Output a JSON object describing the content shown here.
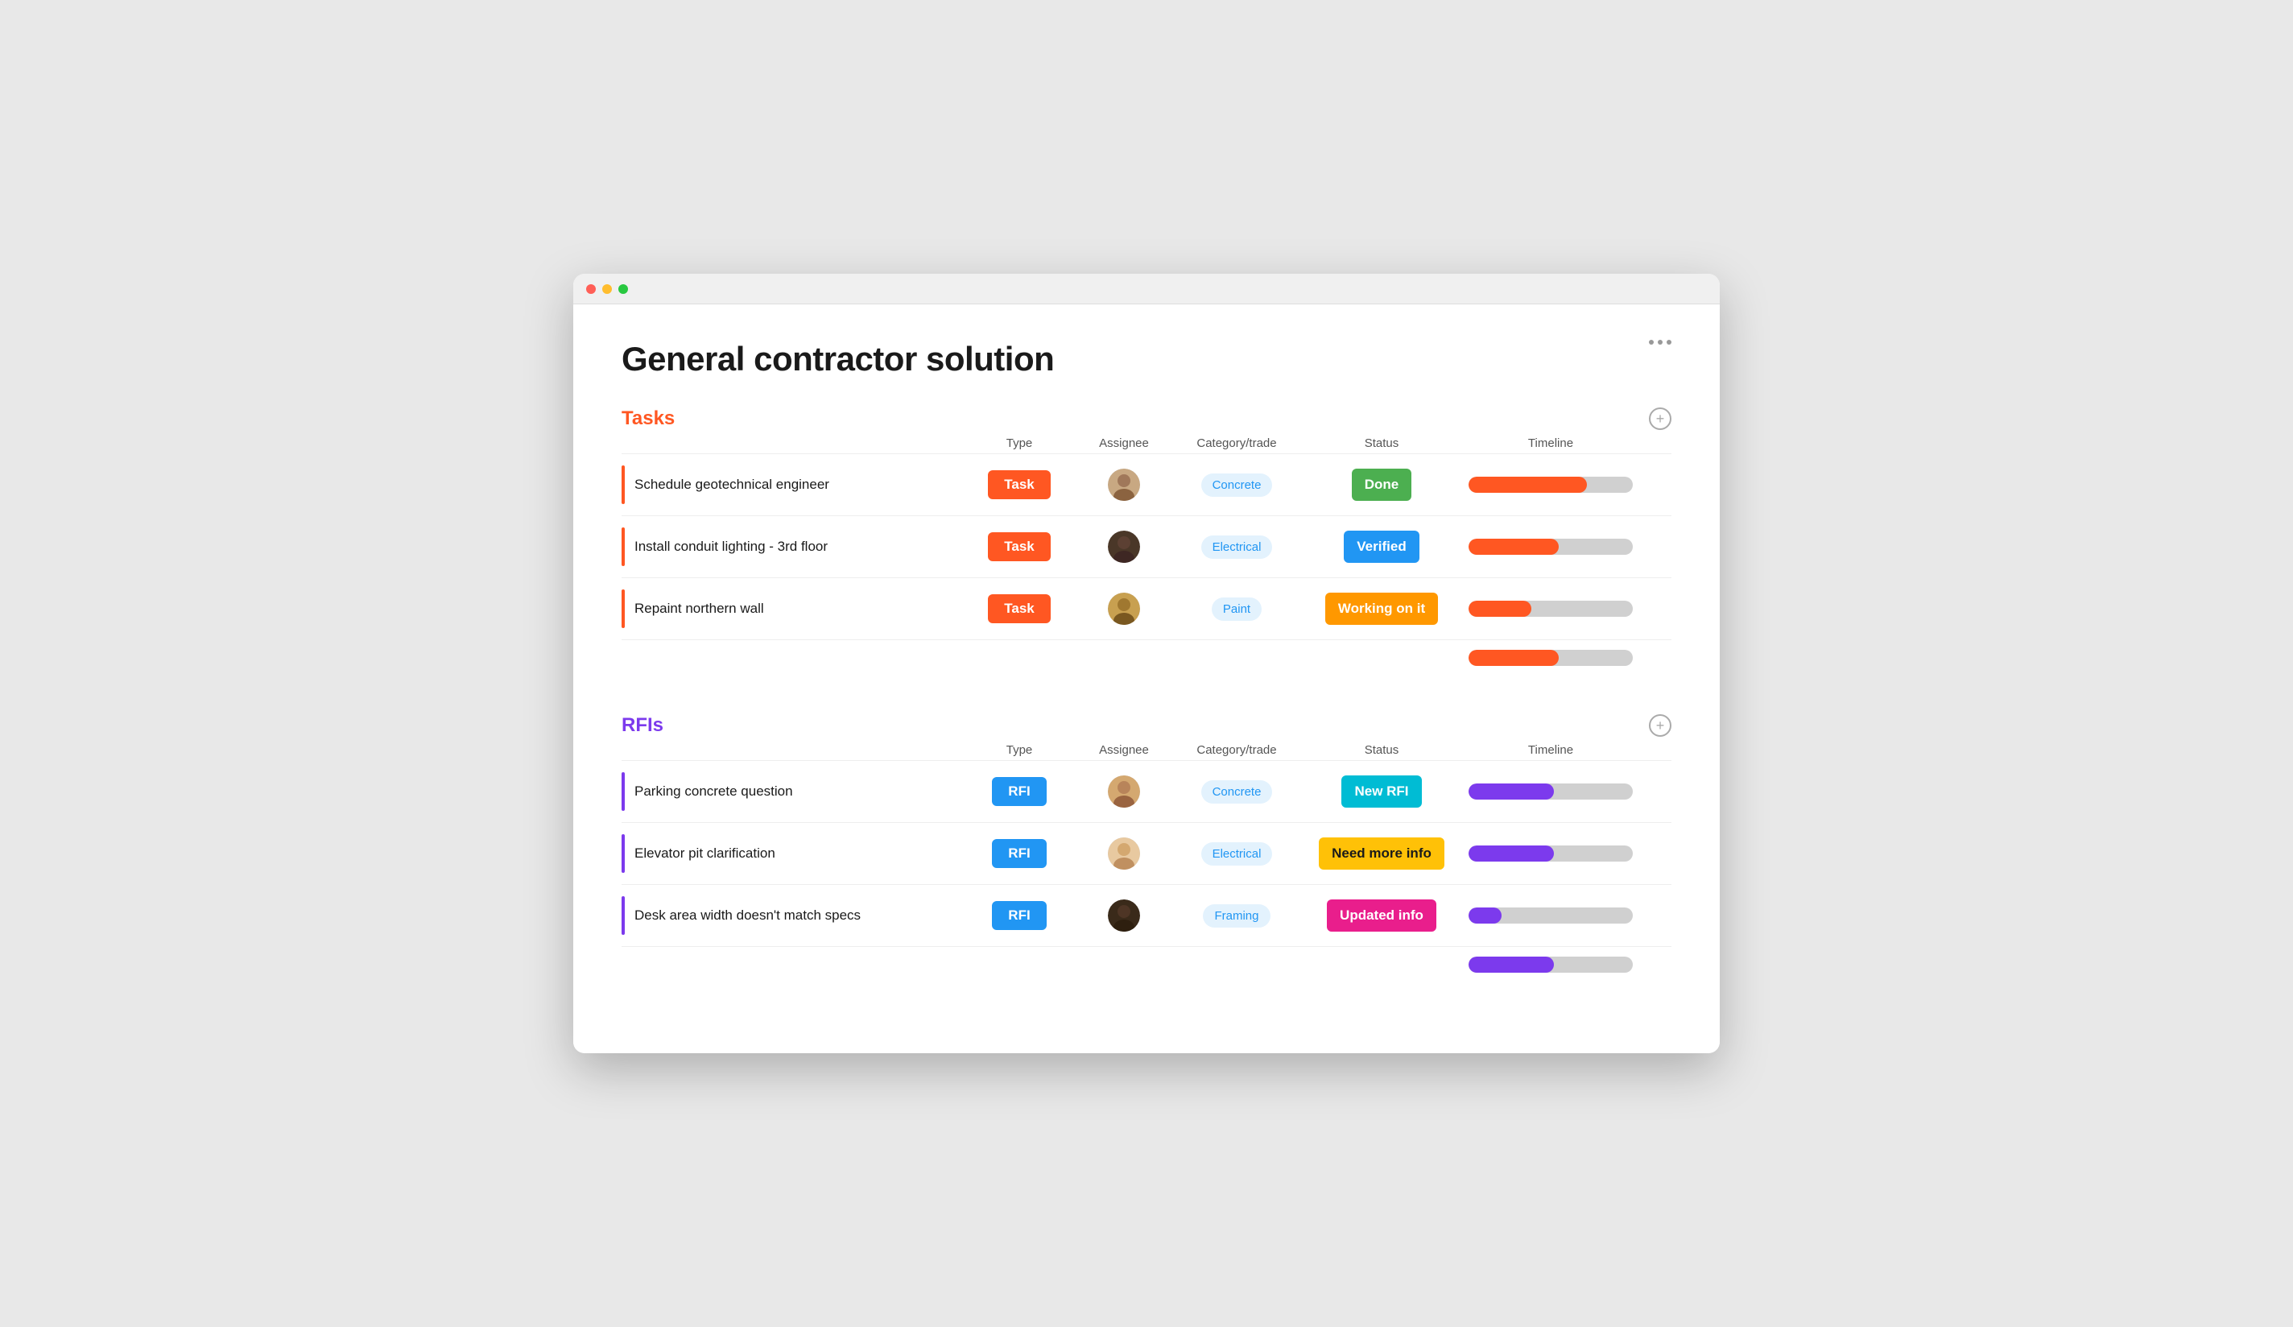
{
  "window": {
    "title": "General contractor solution"
  },
  "page": {
    "title": "General contractor solution",
    "more_menu_label": "..."
  },
  "colors": {
    "task_orange": "#ff5722",
    "rfi_purple": "#7c3aed",
    "done_green": "#4caf50",
    "verified_blue": "#2196f3",
    "working_orange": "#ff9800",
    "new_rfi_cyan": "#00bcd4",
    "need_more_yellow": "#ffc107",
    "updated_pink": "#e91e8c"
  },
  "tasks_section": {
    "title": "Tasks",
    "col_headers": [
      "",
      "Type",
      "Assignee",
      "Category/trade",
      "Status",
      "Timeline",
      ""
    ],
    "rows": [
      {
        "name": "Schedule geotechnical engineer",
        "type": "Task",
        "category": "Concrete",
        "status": "Done",
        "timeline_pct": 72
      },
      {
        "name": "Install conduit lighting - 3rd floor",
        "type": "Task",
        "category": "Electrical",
        "status": "Verified",
        "timeline_pct": 55
      },
      {
        "name": "Repaint northern wall",
        "type": "Task",
        "category": "Paint",
        "status": "Working on it",
        "timeline_pct": 38
      }
    ],
    "extra_timeline_pct": 55
  },
  "rfis_section": {
    "title": "RFIs",
    "col_headers": [
      "",
      "Type",
      "Assignee",
      "Category/trade",
      "Status",
      "Timeline",
      ""
    ],
    "rows": [
      {
        "name": "Parking concrete question",
        "type": "RFI",
        "category": "Concrete",
        "status": "New RFI",
        "timeline_pct": 52
      },
      {
        "name": "Elevator pit clarification",
        "type": "RFI",
        "category": "Electrical",
        "status": "Need more info",
        "timeline_pct": 52
      },
      {
        "name": "Desk area width doesn't match specs",
        "type": "RFI",
        "category": "Framing",
        "status": "Updated info",
        "timeline_pct": 20
      }
    ],
    "extra_timeline_pct": 52
  },
  "avatars": {
    "task_1": "man1",
    "task_2": "man2",
    "task_3": "man3",
    "rfi_1": "man4",
    "rfi_2": "woman1",
    "rfi_3": "man5"
  }
}
